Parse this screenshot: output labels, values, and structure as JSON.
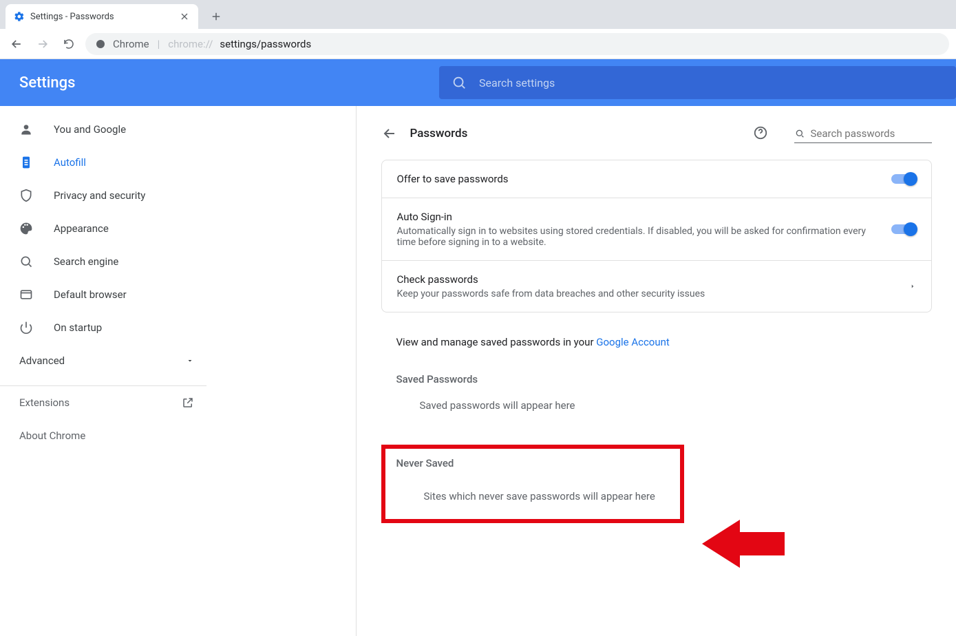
{
  "browser": {
    "tab_title": "Settings - Passwords",
    "omnibox_prefix": "Chrome",
    "omnibox_scheme": "chrome://",
    "omnibox_path": "settings/passwords"
  },
  "header": {
    "title": "Settings",
    "search_placeholder": "Search settings"
  },
  "sidebar": {
    "items": [
      {
        "label": "You and Google"
      },
      {
        "label": "Autofill"
      },
      {
        "label": "Privacy and security"
      },
      {
        "label": "Appearance"
      },
      {
        "label": "Search engine"
      },
      {
        "label": "Default browser"
      },
      {
        "label": "On startup"
      }
    ],
    "advanced": "Advanced",
    "extensions": "Extensions",
    "about": "About Chrome"
  },
  "page": {
    "title": "Passwords",
    "search_placeholder": "Search passwords",
    "offer_label": "Offer to save passwords",
    "autosignin_label": "Auto Sign-in",
    "autosignin_sub": "Automatically sign in to websites using stored credentials. If disabled, you will be asked for confirmation every time before signing in to a website.",
    "check_label": "Check passwords",
    "check_sub": "Keep your passwords safe from data breaches and other security issues",
    "view_prefix": "View and manage saved passwords in your ",
    "view_link": "Google Account",
    "saved_title": "Saved Passwords",
    "saved_empty": "Saved passwords will appear here",
    "never_title": "Never Saved",
    "never_empty": "Sites which never save passwords will appear here"
  }
}
